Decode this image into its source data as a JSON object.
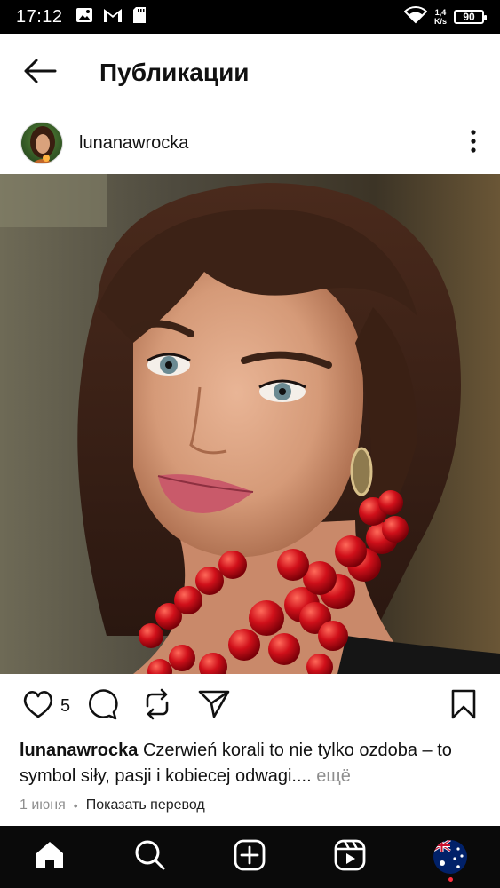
{
  "status_bar": {
    "time": "17:12",
    "network_speed_value": "1,4",
    "network_speed_unit": "K/s",
    "battery": "90",
    "icons": [
      "image-icon",
      "gmail-icon",
      "sd-card-icon",
      "wifi-icon",
      "battery-icon"
    ]
  },
  "header": {
    "title": "Публикации",
    "back_icon": "arrow-left-icon"
  },
  "post": {
    "username": "lunanawrocka",
    "like_count": "5",
    "caption_user": "lunanawrocka",
    "caption_text": "Czerwień korali to nie tylko ozdoba – to symbol siły, pasji i kobiecej odwagi....",
    "caption_more": " ещё",
    "date": "1 июня",
    "translate_label": "Показать перевод"
  },
  "bottom_nav": {
    "items": [
      "home-icon",
      "search-icon",
      "create-icon",
      "reels-icon",
      "profile-avatar"
    ]
  },
  "colors": {
    "background": "#ffffff",
    "status_bar": "#000000",
    "nav_bar": "#0a0a0a",
    "secondary_text": "#8e8e8e",
    "notification_dot": "#ff3040"
  }
}
